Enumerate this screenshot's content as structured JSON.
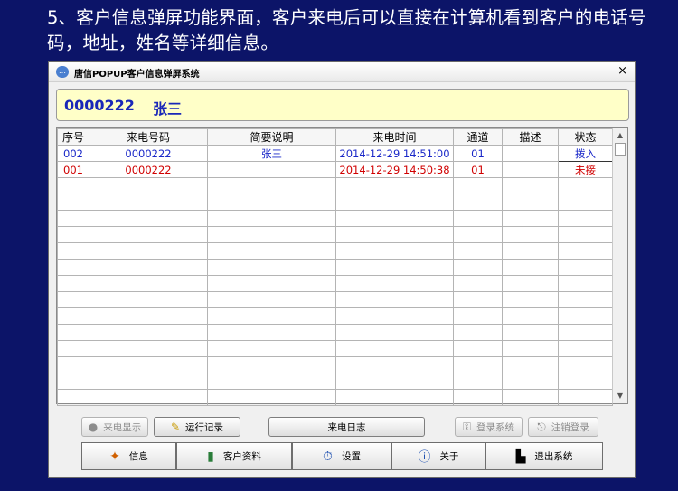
{
  "caption": "5、客户信息弹屏功能界面，客户来电后可以直接在计算机看到客户的电话号码，地址，姓名等详细信息。",
  "window": {
    "title": "唐信POPUP客户信息弹屏系统",
    "close": "×"
  },
  "caller": {
    "number": "0000222",
    "name": "张三"
  },
  "table": {
    "headers": [
      "序号",
      "来电号码",
      "简要说明",
      "来电时间",
      "通道",
      "描述",
      "状态"
    ],
    "rows": [
      {
        "id": "002",
        "number": "0000222",
        "note": "张三",
        "time": "2014-12-29 14:51:00",
        "channel": "01",
        "desc": "",
        "status": "拨入"
      },
      {
        "id": "001",
        "number": "0000222",
        "note": "",
        "time": "2014-12-29 14:50:38",
        "channel": "01",
        "desc": "",
        "status": "未接"
      }
    ]
  },
  "buttons": {
    "incoming_display": "来电显示",
    "run_log": "运行记录",
    "call_log": "来电日志",
    "login": "登录系统",
    "logout": "注销登录"
  },
  "tabs": {
    "info": "信息",
    "customer": "客户资料",
    "settings": "设置",
    "about": "关于",
    "exit": "退出系统"
  }
}
